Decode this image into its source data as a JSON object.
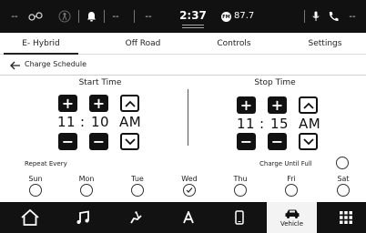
{
  "statusbar": {
    "left_dash": "--",
    "dash2": "--",
    "dash3": "--",
    "time": "2:37",
    "fm_label": "FM",
    "radio": "87.7",
    "right_dash": "--"
  },
  "tabs": [
    {
      "label": "E- Hybrid",
      "active": true
    },
    {
      "label": "Off Road",
      "active": false
    },
    {
      "label": "Controls",
      "active": false
    },
    {
      "label": "Settings",
      "active": false
    }
  ],
  "subheader": {
    "title": "Charge Schedule"
  },
  "start": {
    "title": "Start Time",
    "hour": "11",
    "colon": ":",
    "minute": "10",
    "ampm": "AM"
  },
  "stop": {
    "title": "Stop Time",
    "hour": "11",
    "colon": ":",
    "minute": "15",
    "ampm": "AM"
  },
  "buttons": {
    "plus": "+",
    "minus": "−"
  },
  "repeat_label": "Repeat Every",
  "charge_until_full": "Charge Until Full",
  "days": [
    {
      "label": "Sun",
      "checked": false
    },
    {
      "label": "Mon",
      "checked": false
    },
    {
      "label": "Tue",
      "checked": false
    },
    {
      "label": "Wed",
      "checked": true
    },
    {
      "label": "Thu",
      "checked": false
    },
    {
      "label": "Fri",
      "checked": false
    },
    {
      "label": "Sat",
      "checked": false
    }
  ],
  "bottom_nav": {
    "active_label": "Vehicle",
    "items": [
      "home-icon",
      "music-icon",
      "comfort-icon",
      "nav-icon",
      "phone-icon",
      "vehicle-icon",
      "apps-icon"
    ]
  },
  "colors": {
    "bar_bg": "#111111",
    "panel_bg": "#ffffff",
    "page_bg": "#f3f3f3"
  }
}
